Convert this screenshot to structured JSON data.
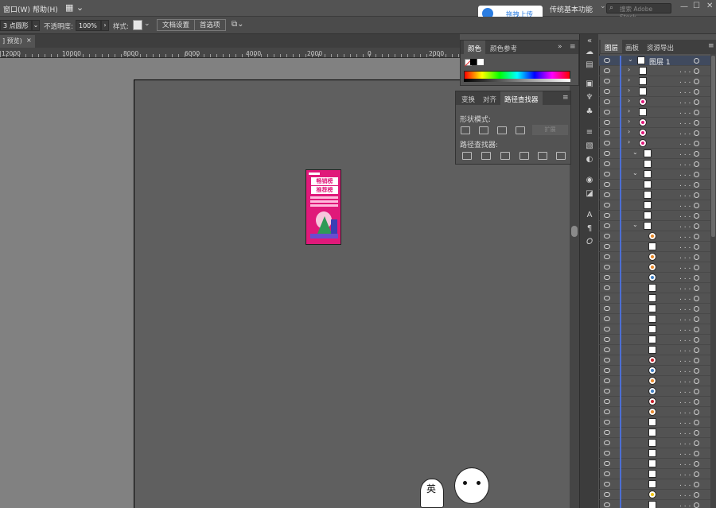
{
  "menu": {
    "window": "窗口(W)",
    "help": "帮助(H)",
    "workspace": "传统基本功能",
    "stock_search": "搜索 Adobe Stock"
  },
  "upload": {
    "label": "拖拽上传"
  },
  "control": {
    "stroke_profile": "3 点圆形",
    "opacity_label": "不透明度:",
    "opacity_value": "100%",
    "style_label": "样式:",
    "doc_setup": "文档设置",
    "prefs": "首选项"
  },
  "doc_tab": {
    "title": "] 预览)",
    "close": "×"
  },
  "ruler": {
    "ticks": [
      "12000",
      "10000",
      "8000",
      "6000",
      "4000",
      "2000",
      "0",
      "2000"
    ]
  },
  "color_panel": {
    "tabs": [
      "颜色",
      "颜色参考"
    ]
  },
  "pathfinder_panel": {
    "tabs": [
      "变换",
      "对齐",
      "路径查找器"
    ],
    "shape_modes_label": "形状模式:",
    "pathfinders_label": "路径查找器:",
    "expand": "扩展"
  },
  "artwork": {
    "line1": "畅销榜",
    "line2": "推荐榜"
  },
  "layers_panel": {
    "tabs": [
      "图层",
      "画板",
      "资源导出"
    ],
    "layer_name": "图层 1",
    "rows": [
      {
        "name": "",
        "thumb": "white"
      },
      {
        "name": "",
        "thumb": "white"
      },
      {
        "name": "",
        "thumb": "white"
      },
      {
        "name": "",
        "thumb": "pink"
      },
      {
        "name": "",
        "thumb": "white"
      },
      {
        "name": "",
        "thumb": "pink"
      },
      {
        "name": "",
        "thumb": "pink"
      },
      {
        "name": "",
        "thumb": "pink"
      },
      {
        "name": "",
        "thumb": "white"
      },
      {
        "name": "",
        "thumb": "white"
      },
      {
        "name": "",
        "thumb": "white"
      },
      {
        "name": "",
        "thumb": "white"
      },
      {
        "name": "",
        "thumb": "white"
      },
      {
        "name": "",
        "thumb": "white"
      },
      {
        "name": "",
        "thumb": "white"
      },
      {
        "name": "",
        "thumb": "white"
      },
      {
        "name": "",
        "thumb": "orange"
      },
      {
        "name": "",
        "thumb": "white"
      },
      {
        "name": "",
        "thumb": "orange"
      },
      {
        "name": "",
        "thumb": "orange"
      },
      {
        "name": "",
        "thumb": "blue"
      },
      {
        "name": "",
        "thumb": "white"
      },
      {
        "name": "",
        "thumb": "white"
      },
      {
        "name": "",
        "thumb": "white"
      },
      {
        "name": "",
        "thumb": "white"
      },
      {
        "name": "",
        "thumb": "white"
      },
      {
        "name": "",
        "thumb": "white"
      },
      {
        "name": "",
        "thumb": "white"
      },
      {
        "name": "",
        "thumb": "red"
      },
      {
        "name": "",
        "thumb": "blue"
      },
      {
        "name": "",
        "thumb": "orange"
      },
      {
        "name": "",
        "thumb": "blue"
      },
      {
        "name": "",
        "thumb": "red"
      },
      {
        "name": "",
        "thumb": "orange"
      },
      {
        "name": "",
        "thumb": "white"
      },
      {
        "name": "",
        "thumb": "white"
      },
      {
        "name": "",
        "thumb": "white"
      },
      {
        "name": "",
        "thumb": "white"
      },
      {
        "name": "",
        "thumb": "white"
      },
      {
        "name": "",
        "thumb": "white"
      },
      {
        "name": "",
        "thumb": "white"
      },
      {
        "name": "",
        "thumb": "yellow"
      },
      {
        "name": "",
        "thumb": "white"
      },
      {
        "name": "",
        "thumb": "white"
      }
    ]
  },
  "sticker": {
    "text": "英"
  },
  "colors": {
    "accent": "#4d6fd3",
    "artwork_pink": "#e0197a",
    "white": "#ffffff",
    "orange": "#e8892b",
    "blue": "#3f7fc4",
    "red": "#c8202a",
    "yellow": "#f1c40f"
  }
}
